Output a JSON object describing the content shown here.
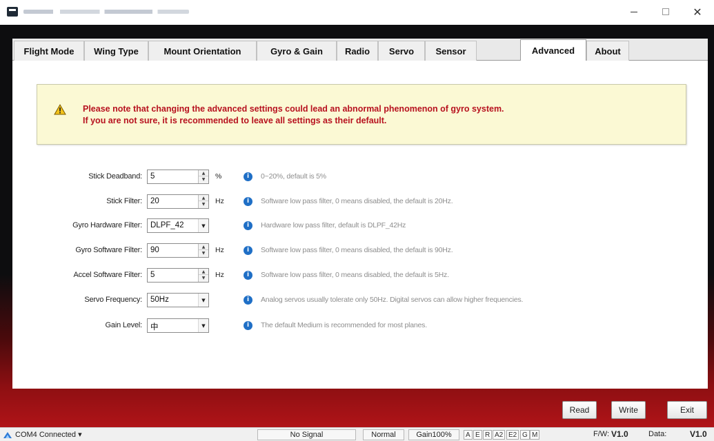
{
  "titlebar": {
    "title": "",
    "controls": {
      "minimize": "—",
      "maximize": "☐",
      "close": "✕"
    }
  },
  "tabs": [
    {
      "label": "Flight Mode",
      "active": false
    },
    {
      "label": "Wing Type",
      "active": false
    },
    {
      "label": "Mount Orientation",
      "active": false
    },
    {
      "label": "Gyro & Gain",
      "active": false
    },
    {
      "label": "Radio",
      "active": false
    },
    {
      "label": "Servo",
      "active": false
    },
    {
      "label": "Sensor",
      "active": false
    },
    {
      "label": "Advanced",
      "active": true
    },
    {
      "label": "About",
      "active": false
    }
  ],
  "warning": {
    "icon": "warning-triangle-icon",
    "line1": "Please note that changing the advanced settings could lead an abnormal phenomenon of gyro system.",
    "line2": "If you are not sure, it is recommended to leave all settings as their default.",
    "color": "#b7121f"
  },
  "settings": [
    {
      "label": "Stick Deadband:",
      "value": "5",
      "control": "spin",
      "unit": "%",
      "hint": "0~20%, default is 5%"
    },
    {
      "label": "Stick Filter:",
      "value": "20",
      "control": "spin",
      "unit": "Hz",
      "hint": "Software low pass filter, 0 means disabled, the default is 20Hz."
    },
    {
      "label": "Gyro Hardware Filter:",
      "value": "DLPF_42",
      "control": "dropdown",
      "unit": "",
      "hint": "Hardware low pass filter, default is DLPF_42Hz"
    },
    {
      "label": "Gyro Software Filter:",
      "value": "90",
      "control": "spin",
      "unit": "Hz",
      "hint": "Software low pass filter, 0 means disabled, the default is 90Hz."
    },
    {
      "label": "Accel Software Filter:",
      "value": "5",
      "control": "spin",
      "unit": "Hz",
      "hint": "Software low pass filter, 0 means disabled, the default is 5Hz."
    },
    {
      "label": "Servo Frequency:",
      "value": "50Hz",
      "control": "dropdown",
      "unit": "",
      "hint": "Analog servos usually tolerate only 50Hz. Digital servos can allow higher frequencies."
    },
    {
      "label": "Gain Level:",
      "value": "中",
      "control": "dropdown",
      "unit": "",
      "hint": "The default Medium is recommended for most planes."
    }
  ],
  "buttons": {
    "read": "Read",
    "write": "Write",
    "exit": "Exit"
  },
  "statusbar": {
    "connection": "COM4 Connected",
    "signal": "No Signal",
    "mode": "Normal",
    "gain": "Gain100%",
    "flags": [
      "A",
      "E",
      "R",
      "A2",
      "E2",
      "G",
      "M"
    ],
    "fw_label": "F/W:",
    "fw_version": "V1.0",
    "data_label": "Data:",
    "data_version": "V1.0"
  },
  "colors": {
    "accent_red": "#b7121f",
    "info_blue": "#1f6fc6",
    "warning_bg": "#fbf9d4",
    "frame_dark": "#0d0d0f",
    "frame_red": "#b01418"
  }
}
